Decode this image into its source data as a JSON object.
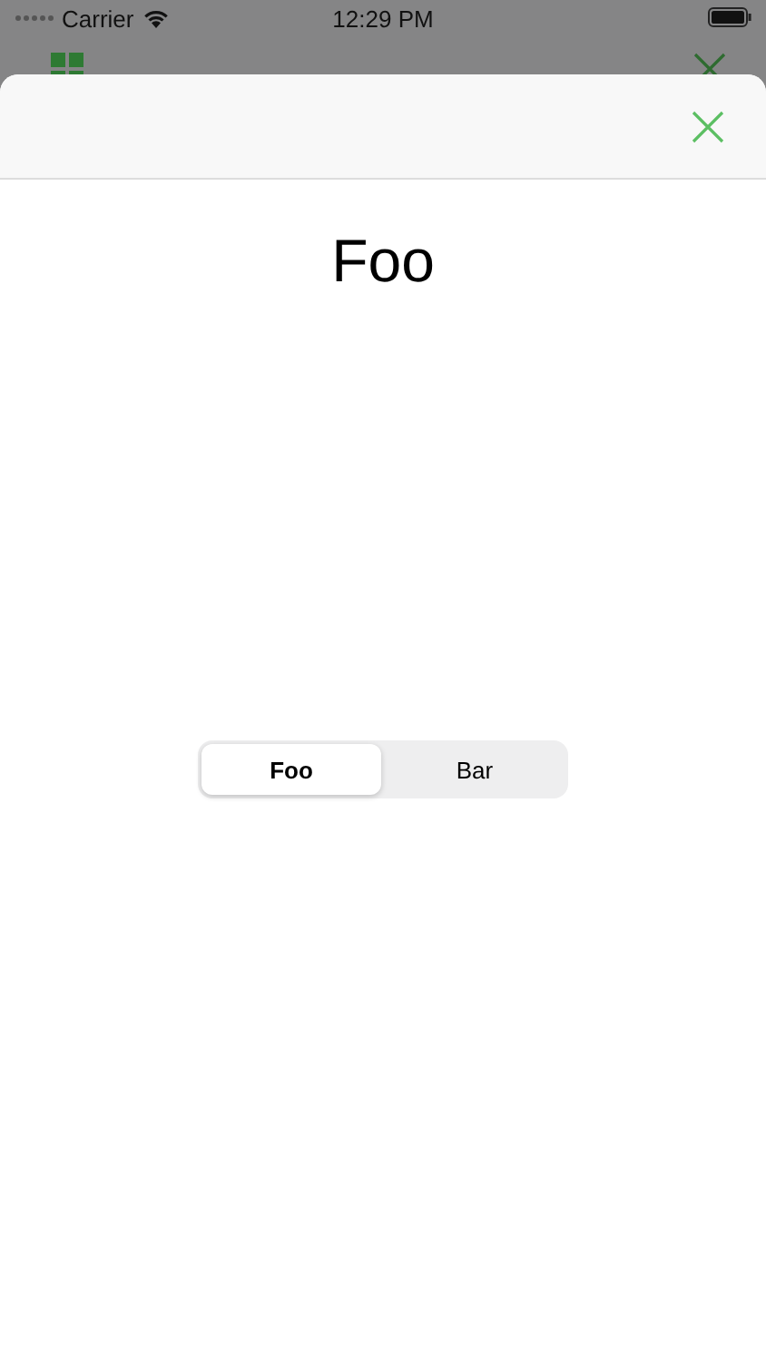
{
  "status_bar": {
    "carrier": "Carrier",
    "time": "12:29 PM"
  },
  "sheet": {
    "heading": "Foo",
    "segments": [
      {
        "label": "Foo",
        "selected": true
      },
      {
        "label": "Bar",
        "selected": false
      }
    ]
  }
}
